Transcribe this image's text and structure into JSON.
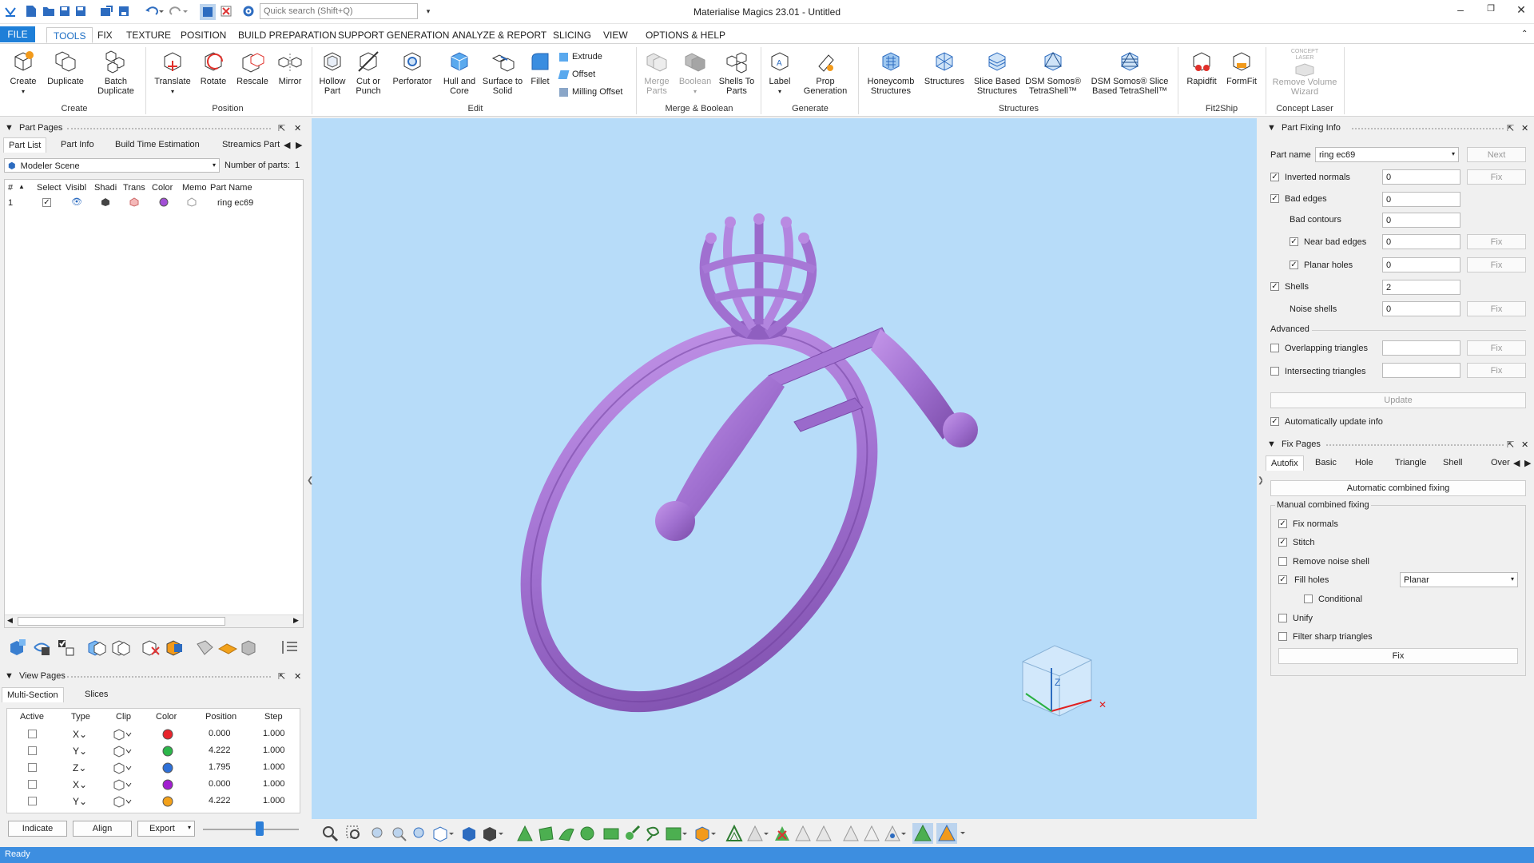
{
  "app": {
    "title": "Materialise Magics 23.01 - Untitled"
  },
  "quick_access": {
    "search_placeholder": "Quick search (Shift+Q)"
  },
  "menu": {
    "tabs": [
      "FILE",
      "TOOLS",
      "FIX",
      "TEXTURE",
      "POSITION",
      "BUILD PREPARATION",
      "SUPPORT GENERATION",
      "ANALYZE & REPORT",
      "SLICING",
      "VIEW",
      "OPTIONS & HELP"
    ],
    "active": "TOOLS"
  },
  "ribbon": {
    "create": {
      "create": "Create",
      "duplicate": "Duplicate",
      "batch_duplicate_1": "Batch",
      "batch_duplicate_2": "Duplicate",
      "group": "Create"
    },
    "position": {
      "translate": "Translate",
      "rotate": "Rotate",
      "rescale": "Rescale",
      "mirror": "Mirror",
      "group": "Position"
    },
    "edit": {
      "hollow_1": "Hollow",
      "hollow_2": "Part",
      "cut_1": "Cut or",
      "cut_2": "Punch",
      "perforator": "Perforator",
      "hull_1": "Hull and",
      "hull_2": "Core",
      "surface_1": "Surface to",
      "surface_2": "Solid",
      "fillet": "Fillet",
      "extrude": "Extrude",
      "offset": "Offset",
      "milling": "Milling Offset",
      "group": "Edit"
    },
    "merge": {
      "merge_1": "Merge",
      "merge_2": "Parts",
      "boolean": "Boolean",
      "shells_1": "Shells To",
      "shells_2": "Parts",
      "group": "Merge & Boolean"
    },
    "generate": {
      "label": "Label",
      "prop_1": "Prop",
      "prop_2": "Generation",
      "group": "Generate"
    },
    "structures": {
      "honeycomb_1": "Honeycomb",
      "honeycomb_2": "Structures",
      "structures": "Structures",
      "slice_1": "Slice Based",
      "slice_2": "Structures",
      "dsm_1": "DSM Somos®",
      "dsm_2": "TetraShell™",
      "dsm_slice_1": "DSM Somos® Slice",
      "dsm_slice_2": "Based TetraShell™",
      "group": "Structures"
    },
    "fit2ship": {
      "rapidfit": "Rapidfit",
      "formfit": "FormFit",
      "group": "Fit2Ship"
    },
    "concept": {
      "icon_text_1": "CONCEPT",
      "icon_text_2": "LASER",
      "remove_1": "Remove Volume",
      "remove_2": "Wizard",
      "group": "Concept Laser"
    }
  },
  "part_pages": {
    "title": "Part Pages",
    "tabs": [
      "Part List",
      "Part Info",
      "Build Time Estimation",
      "Streamics Part"
    ],
    "scene": "Modeler Scene",
    "num_parts_label": "Number of parts:",
    "num_parts": "1",
    "columns": [
      "#",
      "Select",
      "Visibl",
      "Shadi",
      "Trans",
      "Color",
      "Memo",
      "Part Name"
    ],
    "rows": [
      {
        "index": "1",
        "part_name": "ring ec69",
        "color": "#a24fd6"
      }
    ]
  },
  "view_pages": {
    "title": "View Pages",
    "tabs": [
      "Multi-Section",
      "Slices"
    ],
    "columns": [
      "Active",
      "Type",
      "Clip",
      "Color",
      "Position",
      "Step"
    ],
    "rows": [
      {
        "type": "X",
        "color": "#e8242c",
        "position": "0.000",
        "step": "1.000"
      },
      {
        "type": "Y",
        "color": "#2cb64a",
        "position": "4.222",
        "step": "1.000"
      },
      {
        "type": "Z",
        "color": "#2e70d8",
        "position": "1.795",
        "step": "1.000"
      },
      {
        "type": "X",
        "color": "#a11ed0",
        "position": "0.000",
        "step": "1.000"
      },
      {
        "type": "Y",
        "color": "#f3a11a",
        "position": "4.222",
        "step": "1.000"
      }
    ],
    "buttons": {
      "indicate": "Indicate",
      "align": "Align",
      "export": "Export"
    },
    "slider_value": 0.6
  },
  "part_fixing": {
    "title": "Part Fixing Info",
    "part_name_label": "Part name",
    "part_name": "ring ec69",
    "next": "Next",
    "fix": "Fix",
    "inverted_normals": {
      "label": "Inverted normals",
      "value": "0"
    },
    "bad_edges": {
      "label": "Bad edges",
      "value": "0"
    },
    "bad_contours": {
      "label": "Bad contours",
      "value": "0"
    },
    "near_bad_edges": {
      "label": "Near bad edges",
      "value": "0"
    },
    "planar_holes": {
      "label": "Planar holes",
      "value": "0"
    },
    "shells": {
      "label": "Shells",
      "value": "2"
    },
    "noise_shells": {
      "label": "Noise shells",
      "value": "0"
    },
    "advanced": "Advanced",
    "overlapping": {
      "label": "Overlapping triangles",
      "value": ""
    },
    "intersecting": {
      "label": "Intersecting triangles",
      "value": ""
    },
    "update": "Update",
    "auto_update": "Automatically update info"
  },
  "fix_pages": {
    "title": "Fix Pages",
    "tabs": [
      "Autofix",
      "Basic",
      "Hole",
      "Triangle",
      "Shell",
      "Over"
    ],
    "auto_combined": "Automatic combined fixing",
    "manual_group": "Manual combined fixing",
    "fix_normals": "Fix normals",
    "stitch": "Stitch",
    "remove_noise": "Remove noise shell",
    "fill_holes": "Fill holes",
    "fill_mode": "Planar",
    "conditional": "Conditional",
    "unify": "Unify",
    "filter_sharp": "Filter sharp triangles",
    "fix": "Fix"
  },
  "status": {
    "text": "Ready"
  },
  "colors": {
    "accent": "#1e7fd8",
    "viewport_bg": "#b7dcf9",
    "ring": "#a070d0",
    "status_bar": "#3d8ee0"
  }
}
